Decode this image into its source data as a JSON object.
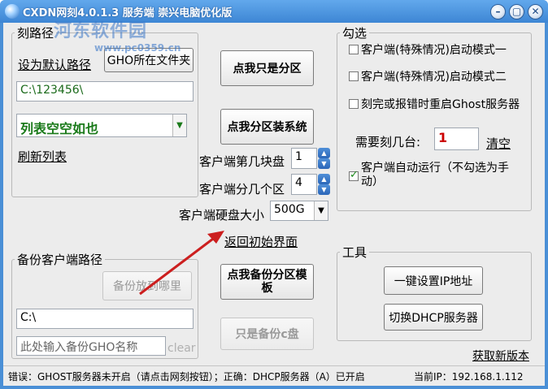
{
  "window": {
    "title": "CXDN网刻4.0.1.3 服务端 崇兴电脑优化版",
    "watermark": "河东软件园",
    "watermark_url": "www.pc0359.cn"
  },
  "path_group": {
    "legend": "刻路径",
    "set_default_link": "设为默认路径",
    "gho_folder_button": "GHO所在文件夹",
    "path_value": "C:\\123456\\",
    "list_value": "列表空空如也",
    "refresh_link": "刷新列表"
  },
  "middle": {
    "partition_only_button": "点我只是分区",
    "partition_install_button": "点我分区装系统",
    "disk_index_label": "客户端第几块盘",
    "disk_index_value": "1",
    "partition_count_label": "客户端分几个区",
    "partition_count_value": "4",
    "disk_size_label": "客户端硬盘大小",
    "disk_size_value": "500G",
    "return_link": "返回初始界面",
    "backup_partition_button": "点我备份分区模板",
    "backup_c_only_button": "只是备份c盘"
  },
  "options_group": {
    "legend": "勾选",
    "opt1": "客户端(特殊情况)启动模式一",
    "opt2": "客户端(特殊情况)启动模式二",
    "opt3": "刻完或报错时重启Ghost服务器",
    "count_label": "需要刻几台:",
    "count_value": "1",
    "clear_link": "清空",
    "opt4": "客户端自动运行（不勾选为手动）"
  },
  "backup_group": {
    "legend": "备份客户端路径",
    "where_button": "备份放到哪里",
    "path_value": "C:\\",
    "name_placeholder": "此处输入备份GHO名称",
    "clear_label": "clear"
  },
  "tools_group": {
    "legend": "工具",
    "set_ip_button": "一键设置IP地址",
    "dhcp_button": "切换DHCP服务器"
  },
  "get_new_link": "获取新版本",
  "status": {
    "error_text": "错误：GHOST服务器未开启（请点击网刻按钮）；正确：DHCP服务器（A）已开启",
    "ip_text": "当前IP：192.168.1.112"
  },
  "colors": {
    "title_bar": "#3d86d4",
    "count_value": "#cc0000",
    "list_value": "#1a7a1a",
    "arrow": "#cc1f1f"
  }
}
